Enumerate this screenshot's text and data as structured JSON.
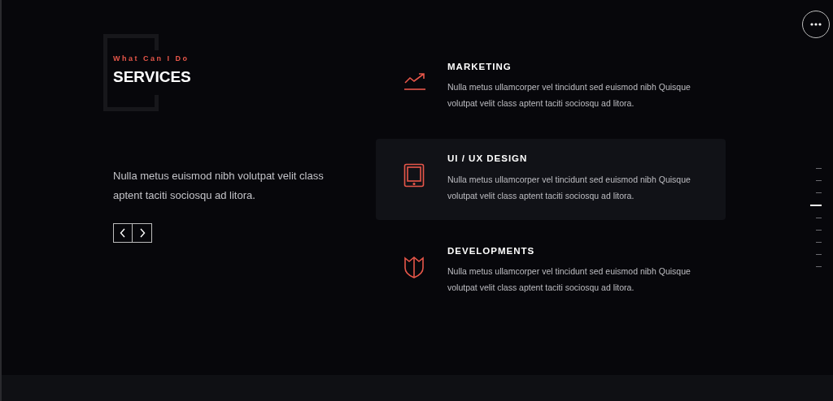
{
  "header": {
    "eyebrow": "What Can I Do",
    "title": "SERVICES"
  },
  "intro": "Nulla metus euismod nibh volutpat velit class aptent taciti sociosqu ad litora.",
  "services": [
    {
      "kind": "chart",
      "title": "MARKETING",
      "text": "Nulla metus ullamcorper vel tincidunt sed euismod nibh Quisque volutpat velit class aptent taciti sociosqu ad litora.",
      "selected": false
    },
    {
      "kind": "tablet",
      "title": "UI / UX DESIGN",
      "text": "Nulla metus ullamcorper vel tincidunt sed euismod nibh Quisque volutpat velit class aptent taciti sociosqu ad litora.",
      "selected": true
    },
    {
      "kind": "shield",
      "title": "DEVELOPMENTS",
      "text": "Nulla metus ullamcorper vel tincidunt sed euismod nibh Quisque volutpat velit class aptent taciti sociosqu ad litora.",
      "selected": false
    }
  ],
  "page_nav": [
    {
      "selected": false
    },
    {
      "selected": false
    },
    {
      "selected": false
    },
    {
      "selected": true
    },
    {
      "selected": false
    },
    {
      "selected": false
    },
    {
      "selected": false
    },
    {
      "selected": false
    },
    {
      "selected": false
    }
  ]
}
